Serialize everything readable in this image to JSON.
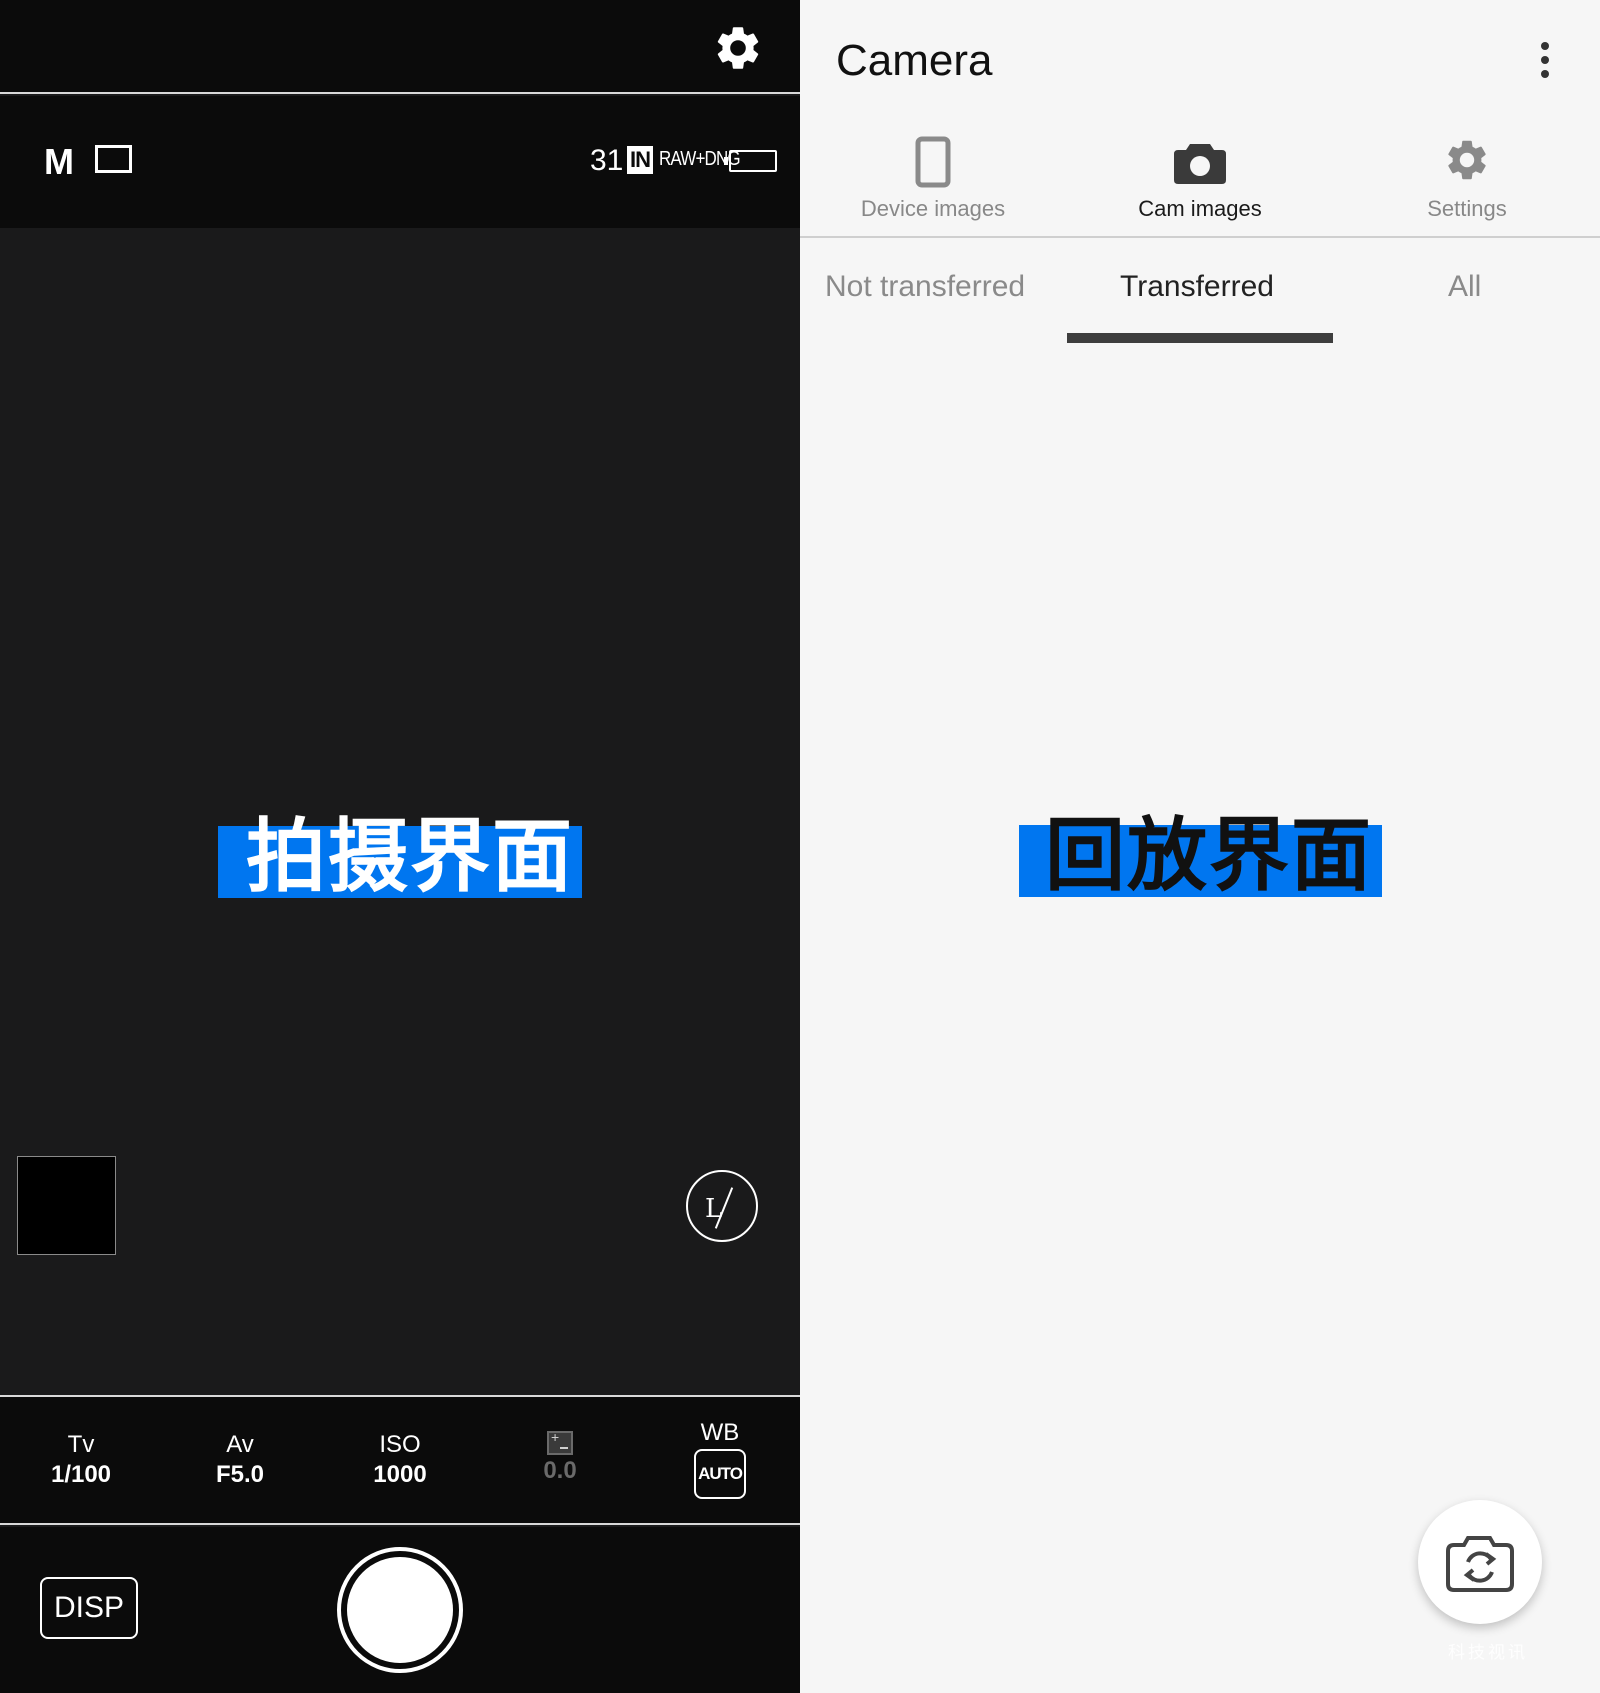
{
  "shooting": {
    "mode": "M",
    "shots_remaining": "31",
    "storage": "IN",
    "quality": "RAW+DNG",
    "overlay_label": "拍摄界面",
    "live_view": "L",
    "exposure": [
      {
        "key": "Tv",
        "value": "1/100"
      },
      {
        "key": "Av",
        "value": "F5.0"
      },
      {
        "key": "ISO",
        "value": "1000"
      },
      {
        "key": "",
        "value": "0.0"
      },
      {
        "key": "WB",
        "value": "AUTO"
      }
    ],
    "disp_label": "DISP"
  },
  "playback": {
    "title": "Camera",
    "nav_tabs": [
      {
        "label": "Device images",
        "icon": "phone-icon"
      },
      {
        "label": "Cam images",
        "icon": "camera-icon"
      },
      {
        "label": "Settings",
        "icon": "gear-icon"
      }
    ],
    "sub_tabs": [
      {
        "label": "Not transferred"
      },
      {
        "label": "Transferred"
      },
      {
        "label": "All"
      }
    ],
    "active_nav": 1,
    "active_sub": 1,
    "overlay_label": "回放界面",
    "watermark_text": "科技视讯"
  },
  "colors": {
    "label_blue": "#0076f0",
    "dark_bar": "#0b0b0b",
    "viewfinder": "#1a1a1b",
    "light_bg": "#f6f6f6"
  }
}
